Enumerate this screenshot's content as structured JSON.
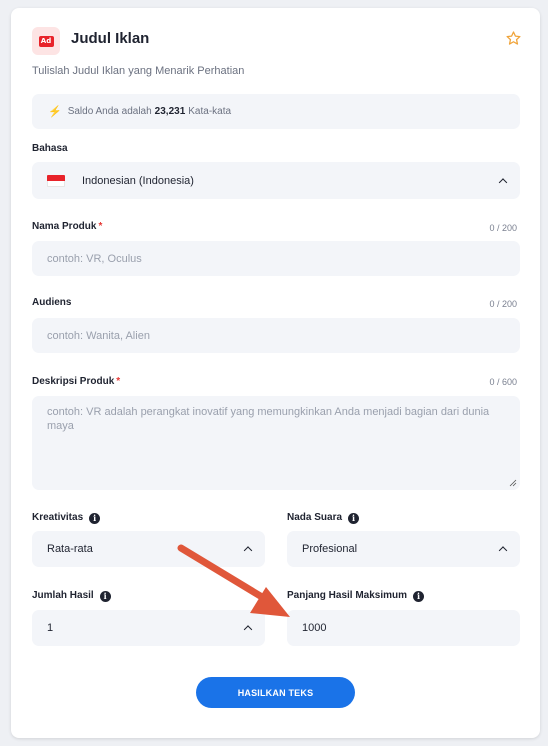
{
  "header": {
    "title": "Judul Iklan",
    "subtitle": "Tulislah Judul Iklan yang Menarik Perhatian",
    "icon_text": "Ad"
  },
  "balance": {
    "prefix": "Saldo Anda adalah",
    "amount": "23,231",
    "suffix": "Kata-kata"
  },
  "language": {
    "label": "Bahasa",
    "value": "Indonesian (Indonesia)"
  },
  "product_name": {
    "label": "Nama Produk",
    "required_mark": "*",
    "counter": "0 / 200",
    "placeholder": "contoh: VR, Oculus"
  },
  "audience": {
    "label": "Audiens",
    "counter": "0 / 200",
    "placeholder": "contoh: Wanita, Alien"
  },
  "description": {
    "label": "Deskripsi Produk",
    "required_mark": "*",
    "counter": "0 / 600",
    "placeholder": "contoh: VR adalah perangkat inovatif yang memungkinkan Anda menjadi bagian dari dunia maya"
  },
  "creativity": {
    "label": "Kreativitas",
    "value": "Rata-rata"
  },
  "tone": {
    "label": "Nada Suara",
    "value": "Profesional"
  },
  "result_count": {
    "label": "Jumlah Hasil",
    "value": "1"
  },
  "max_length": {
    "label": "Panjang Hasil Maksimum",
    "value": "1000"
  },
  "generate_button": {
    "label": "HASILKAN TEKS"
  },
  "colors": {
    "accent": "#1a73e8",
    "arrow": "#e0573a",
    "required": "#e53935"
  }
}
